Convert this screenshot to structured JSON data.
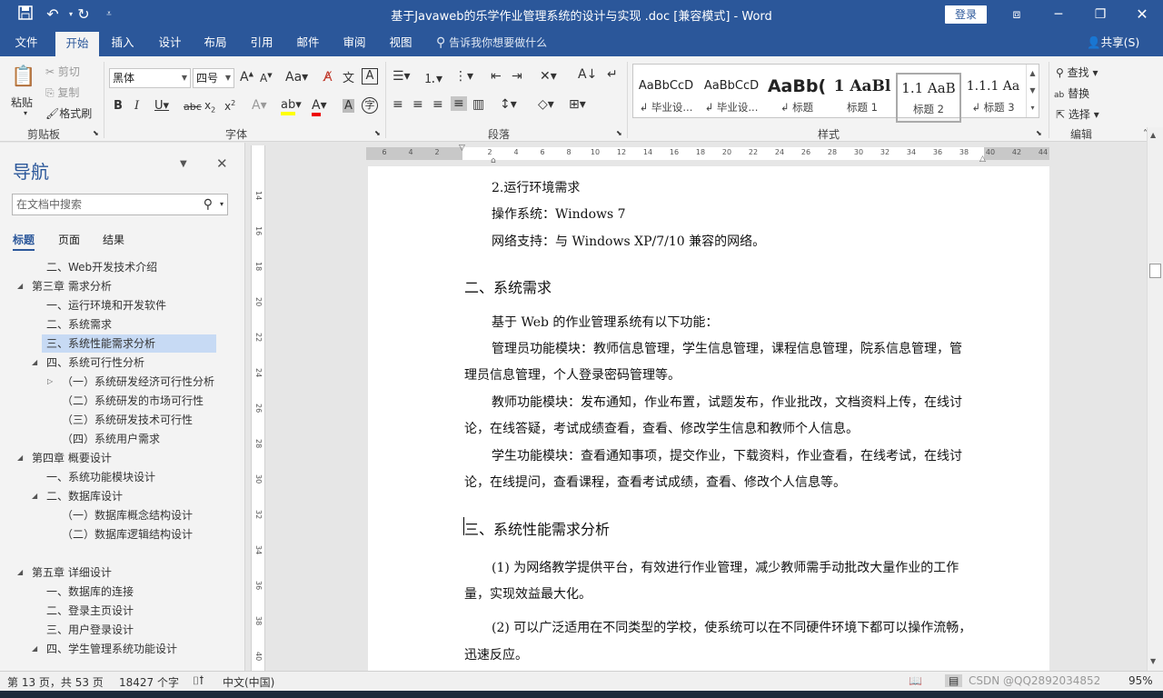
{
  "titlebar": {
    "title": "基于Javaweb的乐学作业管理系统的设计与实现 .doc [兼容模式] - Word",
    "login_label": "登录"
  },
  "tabs": [
    {
      "label": "文件"
    },
    {
      "label": "开始",
      "active": true
    },
    {
      "label": "插入"
    },
    {
      "label": "设计"
    },
    {
      "label": "布局"
    },
    {
      "label": "引用"
    },
    {
      "label": "邮件"
    },
    {
      "label": "审阅"
    },
    {
      "label": "视图"
    }
  ],
  "tell_me": "告诉我你想要做什么",
  "share_label": "共享(S)",
  "ribbon": {
    "clipboard": {
      "paste": "粘贴",
      "cut": "剪切",
      "copy": "复制",
      "format_painter": "格式刷",
      "label": "剪贴板"
    },
    "font": {
      "font_name": "黑体",
      "font_size": "四号",
      "label": "字体"
    },
    "paragraph": {
      "label": "段落"
    },
    "styles": {
      "label": "样式",
      "items": [
        {
          "sample": "AaBbCcD",
          "name": "↲ 毕业设..."
        },
        {
          "sample": "AaBbCcD",
          "name": "↲ 毕业设..."
        },
        {
          "sample": "AaBb(",
          "name": "↲ 标题"
        },
        {
          "sample": "1  AaBl",
          "name": "标题 1"
        },
        {
          "sample": "1.1  AaB",
          "name": "标题 2"
        },
        {
          "sample": "1.1.1  Aa",
          "name": "↲ 标题 3"
        }
      ]
    },
    "editing": {
      "find": "查找",
      "replace": "替换",
      "select": "选择",
      "label": "编辑"
    }
  },
  "nav": {
    "title": "导航",
    "search_placeholder": "在文档中搜索",
    "tabs": [
      "标题",
      "页面",
      "结果"
    ],
    "items": [
      "二、Web开发技术介绍",
      "第三章 需求分析",
      "一、运行环境和开发软件",
      "二、系统需求",
      "三、系统性能需求分析",
      "四、系统可行性分析",
      "（一）系统研发经济可行性分析",
      "（二）系统研发的市场可行性",
      "（三）系统研发技术可行性",
      "（四）系统用户需求",
      "第四章 概要设计",
      "一、系统功能模块设计",
      "二、数据库设计",
      "（一）数据库概念结构设计",
      "（二）数据库逻辑结构设计",
      "第五章 详细设计",
      "一、数据库的连接",
      "二、登录主页设计",
      "三、用户登录设计",
      "四、学生管理系统功能设计"
    ]
  },
  "document": {
    "lines": [
      "2.运行环境需求",
      "操作系统：Windows 7",
      "网络支持：与 Windows XP/7/10 兼容的网络。",
      "二、系统需求",
      "基于 Web 的作业管理系统有以下功能：",
      "管理员功能模块：教师信息管理，学生信息管理，课程信息管理，院系信息管理，管",
      "理员信息管理，个人登录密码管理等。",
      "教师功能模块：发布通知，作业布置，试题发布，作业批改，文档资料上传，在线讨",
      "论，在线答疑，考试成绩查看，查看、修改学生信息和教师个人信息。",
      "学生功能模块：查看通知事项，提交作业，下载资料，作业查看，在线考试，在线讨",
      "论，在线提问，查看课程，查看考试成绩，查看、修改个人信息等。",
      "三、系统性能需求分析",
      "(1) 为网络教学提供平台，有效进行作业管理，减少教师需手动批改大量作业的工作",
      "量，实现效益最大化。",
      "(2) 可以广泛适用在不同类型的学校，使系统可以在不同硬件环境下都可以操作流畅，",
      "迅速反应。"
    ]
  },
  "hruler_ticks": [
    "6",
    "4",
    "2",
    "",
    "2",
    "4",
    "6",
    "8",
    "10",
    "12",
    "14",
    "16",
    "18",
    "20",
    "22",
    "24",
    "26",
    "28",
    "30",
    "32",
    "34",
    "36",
    "38",
    "40",
    "42",
    "44"
  ],
  "vruler_ticks": [
    "14",
    "16",
    "18",
    "20",
    "22",
    "24",
    "26",
    "28",
    "30",
    "32",
    "34",
    "36",
    "38",
    "40"
  ],
  "status": {
    "page": "第 13 页，共 53 页",
    "words": "18427 个字",
    "lang": "中文(中国)",
    "watermark": "CSDN @QQ2892034852",
    "zoom": "95%"
  }
}
